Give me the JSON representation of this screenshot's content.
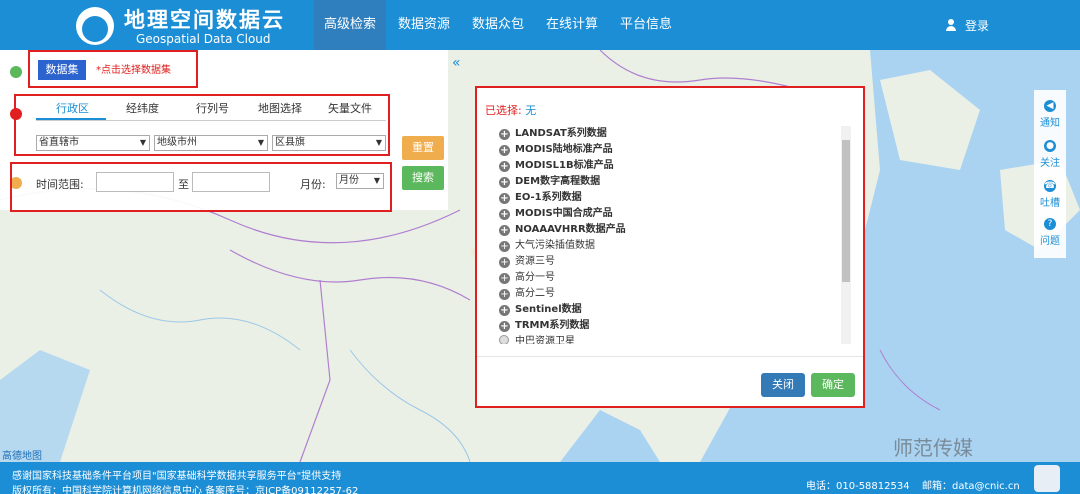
{
  "header": {
    "logo_title": "地理空间数据云",
    "logo_subtitle": "Geospatial Data Cloud",
    "nav": [
      "高级检索",
      "数据资源",
      "数据众包",
      "在线计算",
      "平台信息"
    ],
    "active_nav": "高级检索",
    "login_label": "登录"
  },
  "panel": {
    "dataset_button": "数据集",
    "dataset_hint": "*点击选择数据集",
    "tabs": [
      "行政区",
      "经纬度",
      "行列号",
      "地图选择",
      "矢量文件"
    ],
    "active_tab": "行政区",
    "selects": [
      "省直辖市",
      "地级市州",
      "区县旗"
    ],
    "reset_button": "重置",
    "search_button": "搜索",
    "time_range_label": "时间范围:",
    "to_label": "至",
    "month_label": "月份:",
    "month_select": "月份"
  },
  "modal": {
    "selected_label": "已选择:",
    "selected_value": "无",
    "items": [
      "LANDSAT系列数据",
      "MODIS陆地标准产品",
      "MODISL1B标准产品",
      "DEM数字高程数据",
      "EO-1系列数据",
      "MODIS中国合成产品",
      "NOAAAVHRR数据产品",
      "大气污染插值数据",
      "资源三号",
      "高分一号",
      "高分二号",
      "Sentinel数据",
      "TRMM系列数据"
    ],
    "partial_item": "中巴资源卫星",
    "close_button": "关闭",
    "ok_button": "确定"
  },
  "sidebar": [
    {
      "icon": "speaker-icon",
      "label": "通知"
    },
    {
      "icon": "chat-icon",
      "label": "关注"
    },
    {
      "icon": "phone-icon",
      "label": "吐槽"
    },
    {
      "icon": "question-icon",
      "label": "问题"
    }
  ],
  "map": {
    "credit": "高德地图"
  },
  "watermark": "师范传媒",
  "footer": {
    "line1": "感谢国家科技基础条件平台项目\"国家基础科学数据共享服务平台\"提供支持",
    "line2": "版权所有：中国科学院计算机网络信息中心 备案序号：京ICP备09112257-62",
    "phone": "电话：010-58812534",
    "email": "邮箱：data@cnic.cn"
  },
  "colors": {
    "brand_blue": "#1c8ed6",
    "highlight_red": "#e02020",
    "button_blue": "#2b63cf",
    "button_green": "#5cb85c",
    "button_orange": "#f0ad4e"
  }
}
